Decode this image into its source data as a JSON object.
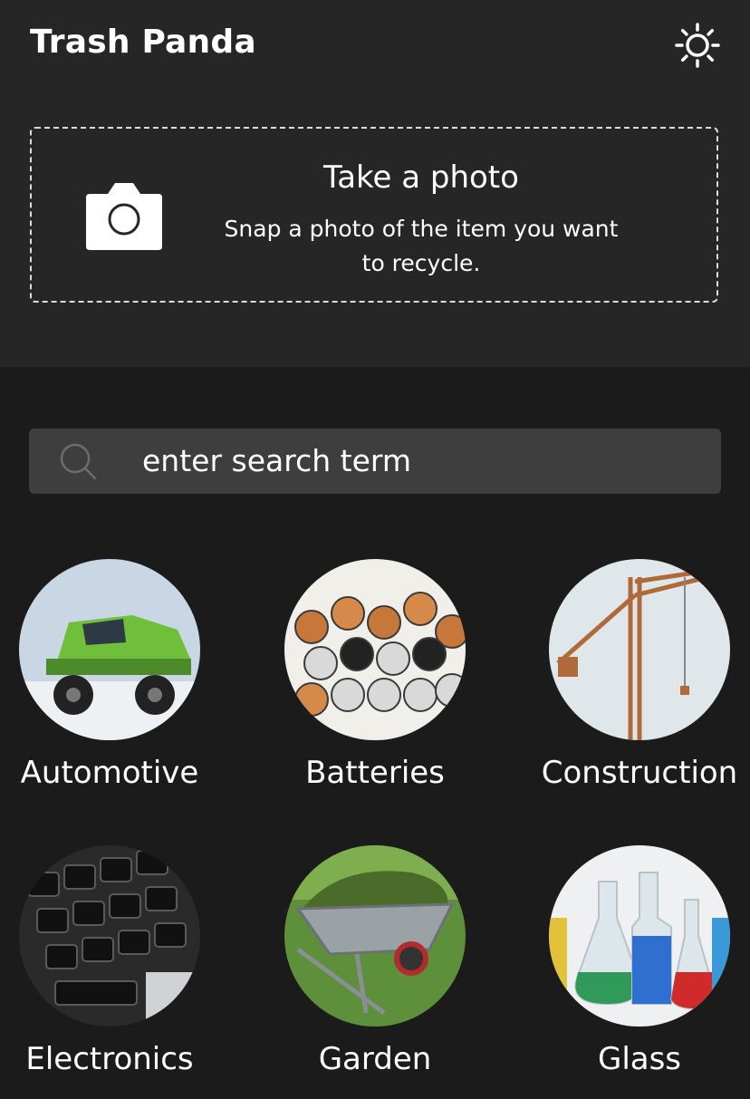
{
  "app": {
    "title": "Trash Panda"
  },
  "header": {
    "theme_icon": "sun-icon"
  },
  "photo": {
    "icon": "camera-icon",
    "title": "Take a photo",
    "description_line1": "Snap a photo of the item you want",
    "description_line2": "to recycle."
  },
  "search": {
    "icon": "search-icon",
    "placeholder": "enter search term"
  },
  "categories": [
    {
      "label": "Automotive"
    },
    {
      "label": "Batteries"
    },
    {
      "label": "Construction"
    },
    {
      "label": "Electronics"
    },
    {
      "label": "Garden"
    },
    {
      "label": "Glass"
    }
  ]
}
